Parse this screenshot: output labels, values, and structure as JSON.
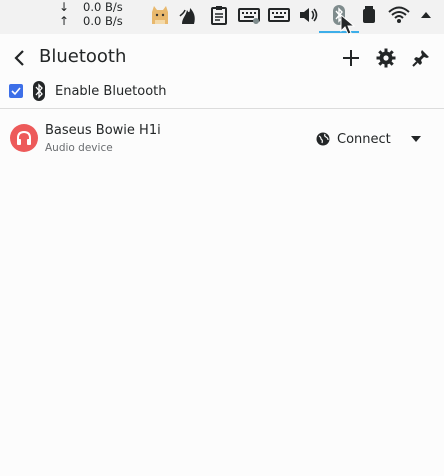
{
  "tray": {
    "download_speed": "0.0 B/s",
    "upload_speed": "0.0 B/s",
    "download_arrow": "↓",
    "upload_arrow": "↑",
    "icons": [
      "cat-icon",
      "fire-icon",
      "clipboard-icon",
      "keyboard-icon",
      "keyboard-alt-icon",
      "volume-icon",
      "bluetooth-icon",
      "battery-icon",
      "wifi-icon",
      "expand-tray-icon"
    ],
    "accent": "#3daee9"
  },
  "header": {
    "title": "Bluetooth"
  },
  "enable": {
    "label": "Enable Bluetooth",
    "checked": true
  },
  "devices": [
    {
      "name": "Baseus Bowie H1i",
      "type": "Audio device",
      "action": "Connect",
      "avatar_color": "#ed5a5a"
    }
  ],
  "colors": {
    "checkbox": "#3d6fe8",
    "avatar": "#ed5a5a"
  }
}
